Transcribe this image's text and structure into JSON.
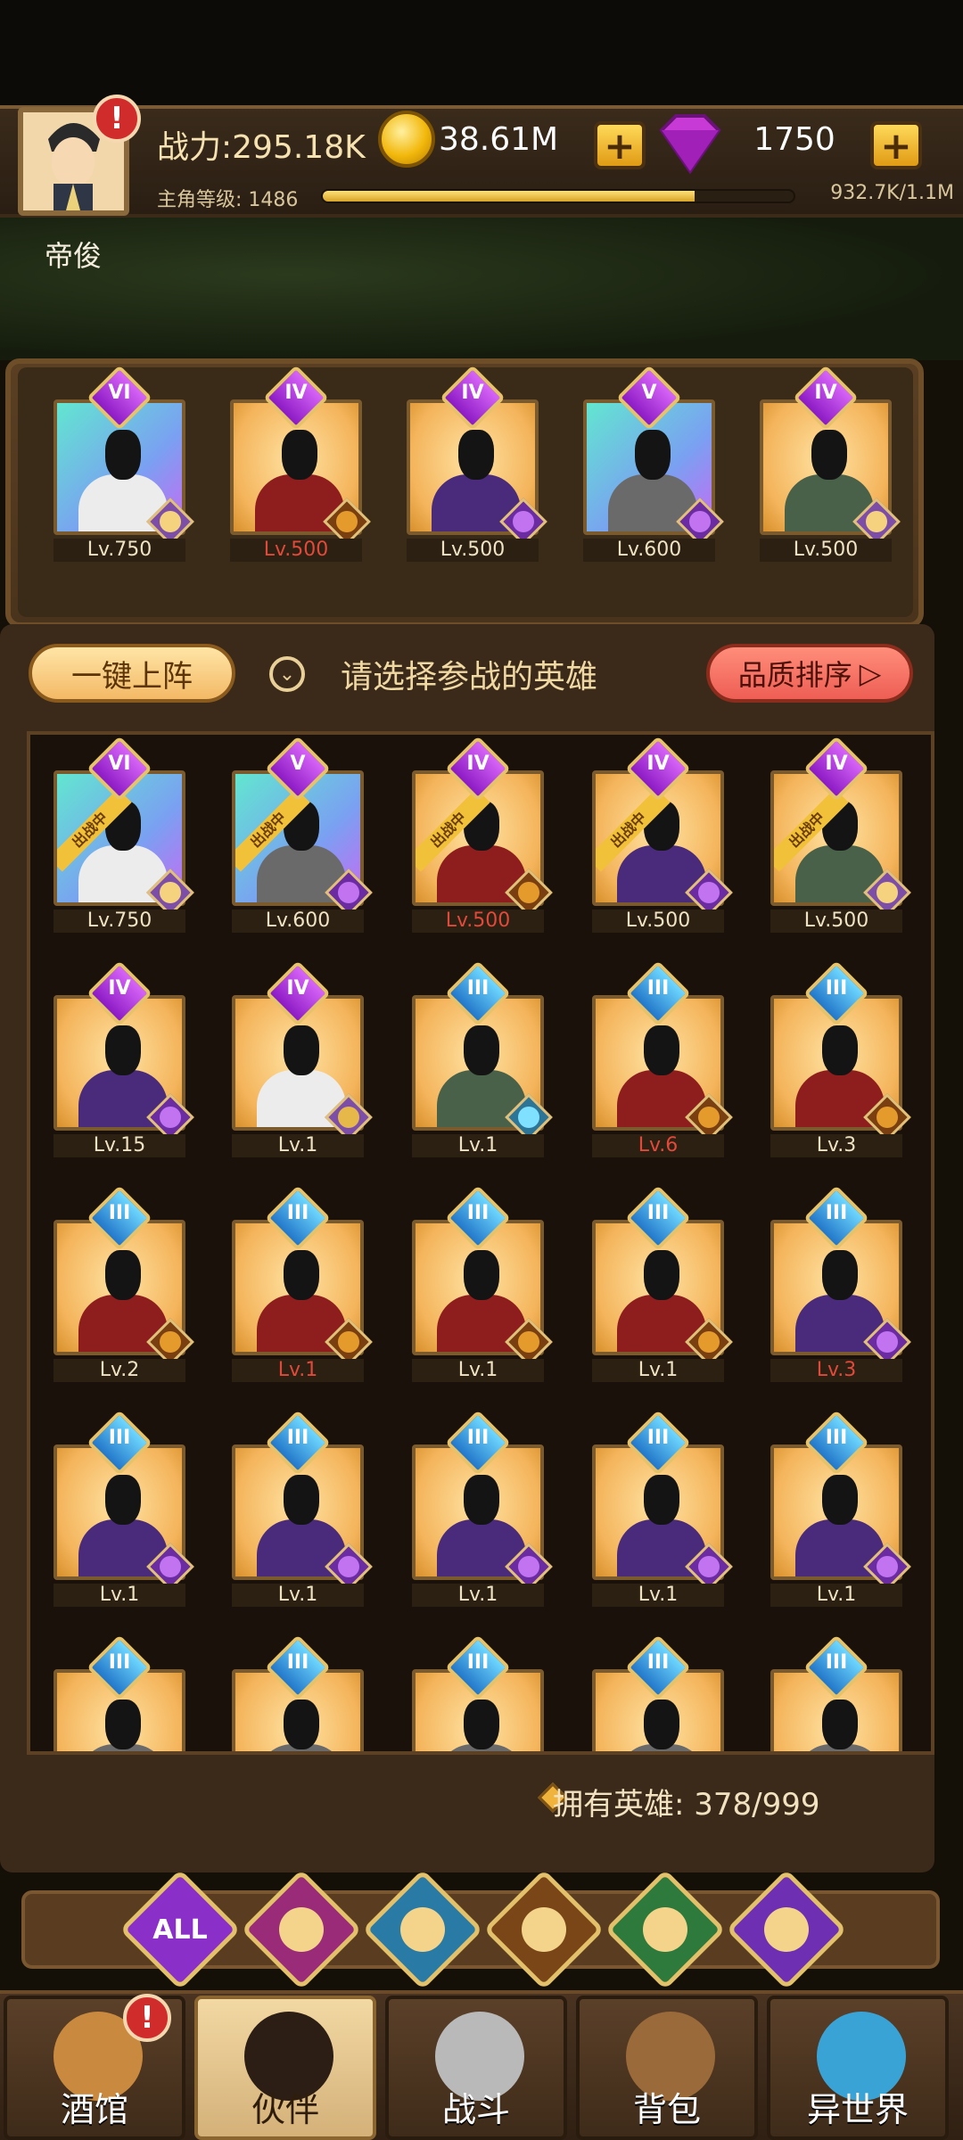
{
  "player": {
    "name": "帝俊",
    "power": "战力:295.18K",
    "level_label": "主角等级: 1486",
    "xp": "932.7K/1.1M",
    "xp_fraction": 0.79,
    "notify": "!"
  },
  "currency": {
    "gold": "38.61M",
    "gems": "1750",
    "plus": "+"
  },
  "team": [
    {
      "rank": "VI",
      "level": "Lv.750",
      "frame": "cyan",
      "armor": "white",
      "faction": "elf",
      "red": false
    },
    {
      "rank": "IV",
      "level": "Lv.500",
      "frame": "gold",
      "armor": "red",
      "faction": "lion",
      "red": true
    },
    {
      "rank": "IV",
      "level": "Lv.500",
      "frame": "gold",
      "armor": "purple",
      "faction": "orc",
      "red": false
    },
    {
      "rank": "V",
      "level": "Lv.600",
      "frame": "cyan",
      "armor": "grey",
      "faction": "orc",
      "red": false
    },
    {
      "rank": "IV",
      "level": "Lv.500",
      "frame": "gold",
      "armor": "green",
      "faction": "elf",
      "red": false
    }
  ],
  "actions": {
    "one_key": "一键上阵",
    "down": "⌄",
    "prompt": "请选择参战的英雄",
    "sort": "品质排序",
    "sort_arrow": "▷"
  },
  "heroes": [
    {
      "rank": "VI",
      "level": "Lv.750",
      "frame": "cyan",
      "armor": "white",
      "faction": "elf",
      "red": false,
      "tag": "出战中"
    },
    {
      "rank": "V",
      "level": "Lv.600",
      "frame": "cyan",
      "armor": "grey",
      "faction": "orc",
      "red": false,
      "tag": "出战中"
    },
    {
      "rank": "IV",
      "level": "Lv.500",
      "frame": "gold",
      "armor": "red",
      "faction": "lion",
      "red": true,
      "tag": "出战中"
    },
    {
      "rank": "IV",
      "level": "Lv.500",
      "frame": "gold",
      "armor": "purple",
      "faction": "orc",
      "red": false,
      "tag": "出战中"
    },
    {
      "rank": "IV",
      "level": "Lv.500",
      "frame": "gold",
      "armor": "green",
      "faction": "elf",
      "red": false,
      "tag": "出战中"
    },
    {
      "rank": "IV",
      "level": "Lv.15",
      "frame": "gold",
      "armor": "purple",
      "faction": "orc",
      "red": false
    },
    {
      "rank": "IV",
      "level": "Lv.1",
      "frame": "gold",
      "armor": "white",
      "faction": "crown",
      "red": false
    },
    {
      "rank": "III",
      "level": "Lv.1",
      "frame": "gold",
      "armor": "green",
      "faction": "cyan",
      "red": false
    },
    {
      "rank": "III",
      "level": "Lv.6",
      "frame": "gold",
      "armor": "red",
      "faction": "lion",
      "red": true
    },
    {
      "rank": "III",
      "level": "Lv.3",
      "frame": "gold",
      "armor": "red",
      "faction": "lion",
      "red": false
    },
    {
      "rank": "III",
      "level": "Lv.2",
      "frame": "gold",
      "armor": "red",
      "faction": "lion",
      "red": false
    },
    {
      "rank": "III",
      "level": "Lv.1",
      "frame": "gold",
      "armor": "red",
      "faction": "lion",
      "red": true
    },
    {
      "rank": "III",
      "level": "Lv.1",
      "frame": "gold",
      "armor": "red",
      "faction": "lion",
      "red": false
    },
    {
      "rank": "III",
      "level": "Lv.1",
      "frame": "gold",
      "armor": "red",
      "faction": "lion",
      "red": false
    },
    {
      "rank": "III",
      "level": "Lv.3",
      "frame": "gold",
      "armor": "purple",
      "faction": "orc",
      "red": true
    },
    {
      "rank": "III",
      "level": "Lv.1",
      "frame": "gold",
      "armor": "purple",
      "faction": "orc",
      "red": false
    },
    {
      "rank": "III",
      "level": "Lv.1",
      "frame": "gold",
      "armor": "purple",
      "faction": "orc",
      "red": false
    },
    {
      "rank": "III",
      "level": "Lv.1",
      "frame": "gold",
      "armor": "purple",
      "faction": "orc",
      "red": false
    },
    {
      "rank": "III",
      "level": "Lv.1",
      "frame": "gold",
      "armor": "purple",
      "faction": "orc",
      "red": false
    },
    {
      "rank": "III",
      "level": "Lv.1",
      "frame": "gold",
      "armor": "purple",
      "faction": "orc",
      "red": false
    },
    {
      "rank": "III",
      "level": "",
      "frame": "gold",
      "armor": "grey",
      "faction": "",
      "red": false
    },
    {
      "rank": "III",
      "level": "",
      "frame": "gold",
      "armor": "grey",
      "faction": "",
      "red": false
    },
    {
      "rank": "III",
      "level": "",
      "frame": "gold",
      "armor": "grey",
      "faction": "",
      "red": false
    },
    {
      "rank": "III",
      "level": "",
      "frame": "gold",
      "armor": "grey",
      "faction": "",
      "red": false
    },
    {
      "rank": "III",
      "level": "",
      "frame": "gold",
      "armor": "grey",
      "faction": "",
      "red": false
    }
  ],
  "owned": "拥有英雄: 378/999",
  "filters": [
    {
      "name": "all",
      "label": "ALL",
      "color": "#8b2fc9"
    },
    {
      "name": "crown",
      "label": "",
      "color": "#9a2b78"
    },
    {
      "name": "cyan",
      "label": "",
      "color": "#2a7aa6"
    },
    {
      "name": "lion",
      "label": "",
      "color": "#7a4617"
    },
    {
      "name": "elf",
      "label": "",
      "color": "#2d7a3c"
    },
    {
      "name": "orc",
      "label": "",
      "color": "#6e2fb3"
    }
  ],
  "nav": [
    {
      "name": "tavern",
      "label": "酒馆",
      "notify": "!"
    },
    {
      "name": "partner",
      "label": "伙伴"
    },
    {
      "name": "battle",
      "label": "战斗"
    },
    {
      "name": "bag",
      "label": "背包"
    },
    {
      "name": "otherworld",
      "label": "异世界"
    }
  ]
}
